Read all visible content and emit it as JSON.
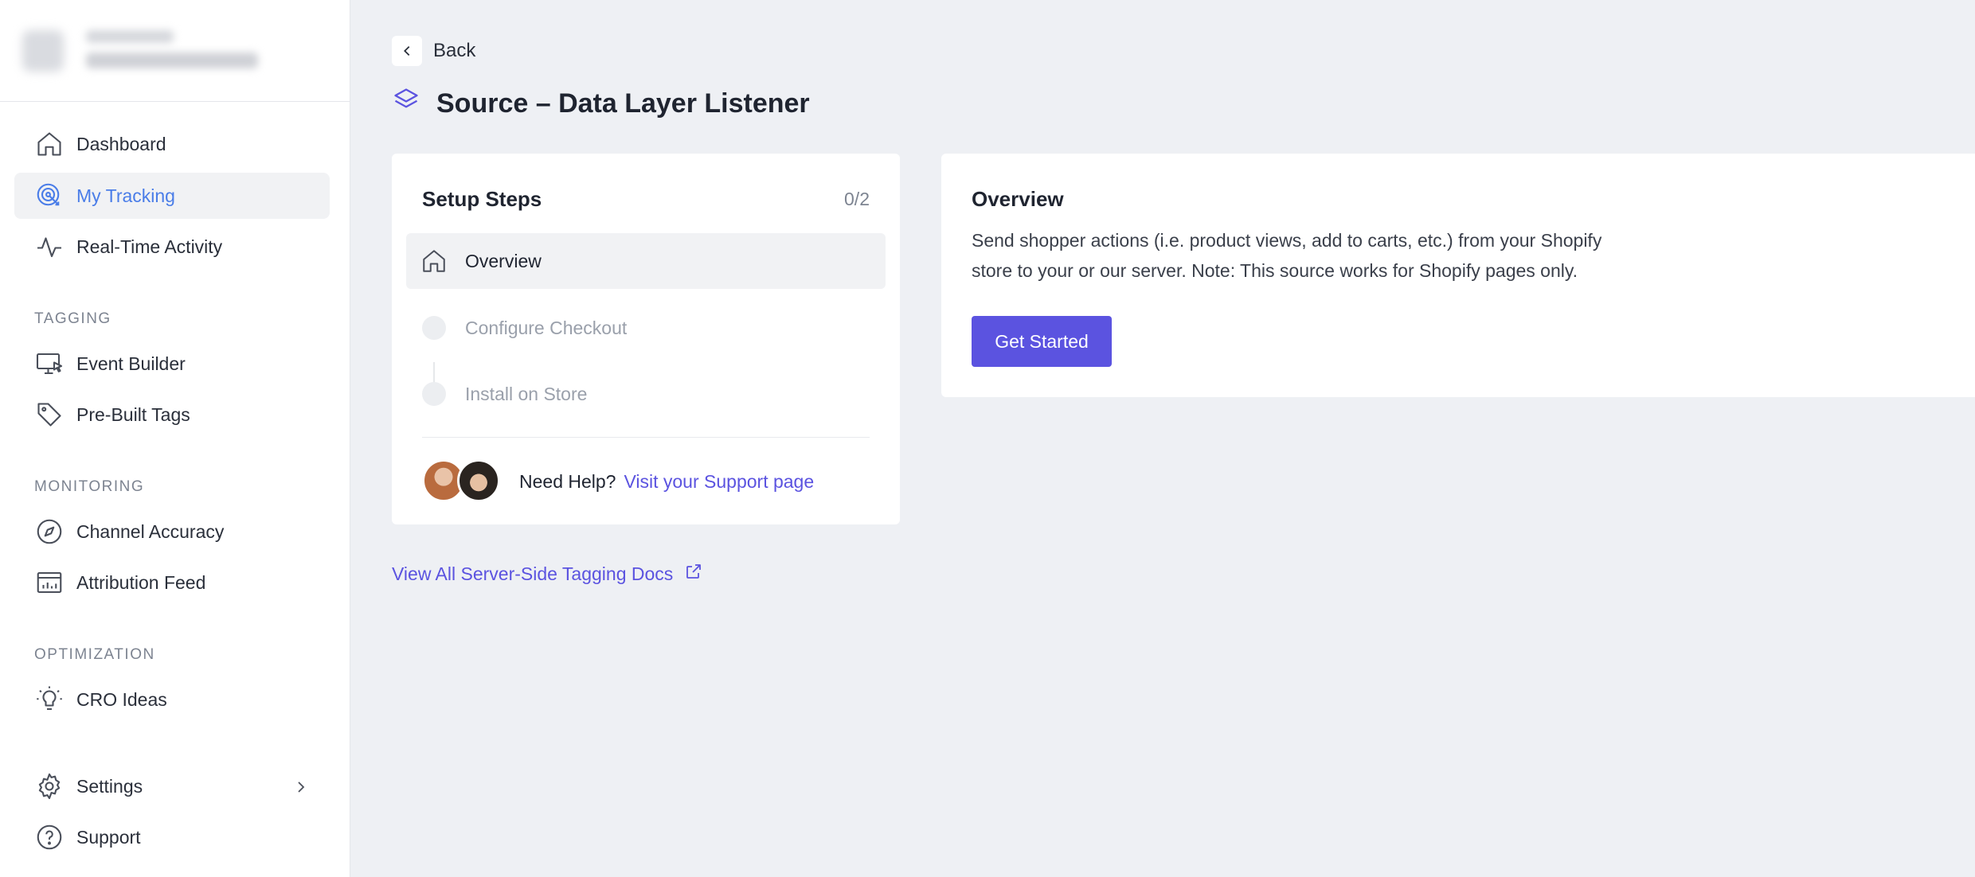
{
  "sidebar": {
    "nav_top": [
      {
        "label": "Dashboard",
        "icon": "home-icon"
      },
      {
        "label": "My Tracking",
        "icon": "target-icon",
        "active": true
      },
      {
        "label": "Real-Time Activity",
        "icon": "activity-icon"
      }
    ],
    "sections": {
      "tagging": "TAGGING",
      "monitoring": "MONITORING",
      "optimization": "OPTIMIZATION"
    },
    "tagging_items": [
      {
        "label": "Event Builder",
        "icon": "monitor-cursor-icon"
      },
      {
        "label": "Pre-Built Tags",
        "icon": "tag-icon"
      }
    ],
    "monitoring_items": [
      {
        "label": "Channel Accuracy",
        "icon": "compass-icon"
      },
      {
        "label": "Attribution Feed",
        "icon": "chart-feed-icon"
      }
    ],
    "optimization_items": [
      {
        "label": "CRO Ideas",
        "icon": "lightbulb-icon"
      }
    ],
    "bottom_items": [
      {
        "label": "Settings",
        "icon": "gear-icon"
      },
      {
        "label": "Support",
        "icon": "help-circle-icon"
      }
    ]
  },
  "header": {
    "back_label": "Back",
    "title": "Source – Data Layer Listener"
  },
  "setup": {
    "title": "Setup Steps",
    "count": "0/2",
    "steps": [
      {
        "label": "Overview",
        "state": "active"
      },
      {
        "label": "Configure Checkout",
        "state": "pending"
      },
      {
        "label": "Install on Store",
        "state": "pending"
      }
    ],
    "help_text": "Need Help?",
    "help_link": "Visit your Support page"
  },
  "overview": {
    "title": "Overview",
    "description_line1": "Send shopper actions (i.e. product views, add to carts, etc.) from your Shopify",
    "description_line2": "store to your or our server. Note: This source works for Shopify pages only.",
    "cta": "Get Started"
  },
  "docs_link": "View All Server-Side Tagging Docs",
  "colors": {
    "accent": "#5b53e0",
    "active_nav": "#4a7de8",
    "background": "#eef0f4"
  }
}
